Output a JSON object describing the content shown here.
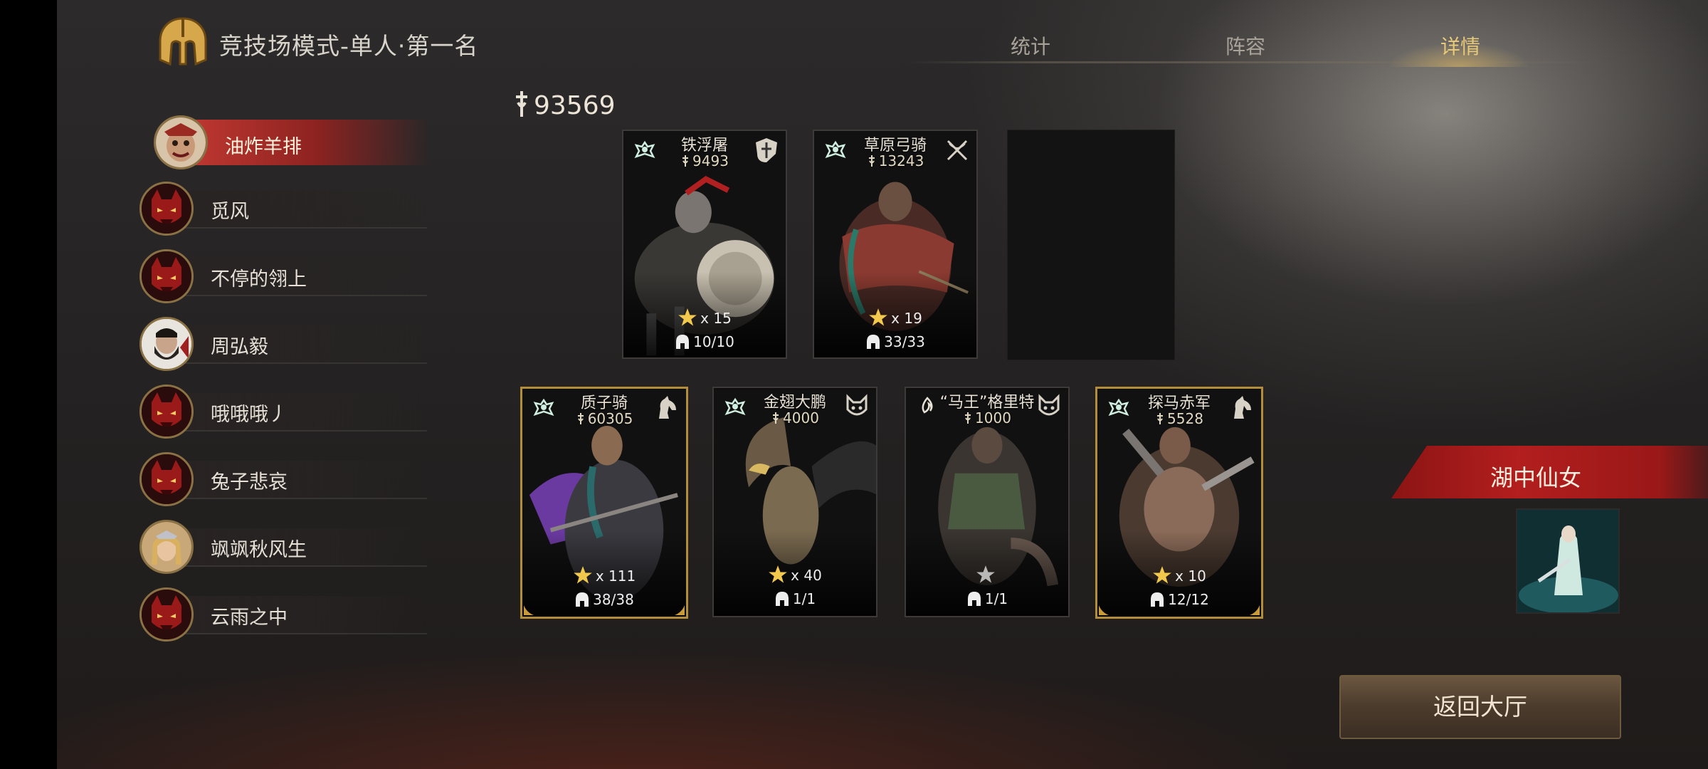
{
  "header": {
    "mode_title": "竞技场模式-单人·第一名",
    "tabs": [
      {
        "label": "统计",
        "active": false
      },
      {
        "label": "阵容",
        "active": false
      },
      {
        "label": "详情",
        "active": true
      }
    ]
  },
  "players": [
    {
      "name": "油炸羊排",
      "avatar": "jester-avatar",
      "selected": true
    },
    {
      "name": "觅风",
      "avatar": "demon-mask-avatar"
    },
    {
      "name": "不停的翎上",
      "avatar": "demon-mask-avatar"
    },
    {
      "name": "周弘毅",
      "avatar": "bearded-warrior-avatar"
    },
    {
      "name": "哦哦哦丿",
      "avatar": "demon-mask-avatar"
    },
    {
      "name": "兔子悲哀",
      "avatar": "demon-mask-avatar"
    },
    {
      "name": "飒飒秋风生",
      "avatar": "female-warrior-avatar"
    },
    {
      "name": "云雨之中",
      "avatar": "demon-mask-avatar"
    }
  ],
  "power_total": "93569",
  "units_row1": [
    {
      "name": "铁浮屠",
      "power": "9493",
      "stars": "x 15",
      "count": "10/10",
      "class_icon": "shield-cross-icon",
      "gold": false
    },
    {
      "name": "草原弓骑",
      "power": "13243",
      "stars": "x 19",
      "count": "33/33",
      "class_icon": "crossed-bow-icon",
      "gold": false
    }
  ],
  "units_row2": [
    {
      "name": "质子骑",
      "power": "60305",
      "stars": "x 111",
      "count": "38/38",
      "class_icon": "horse-head-icon",
      "gold": true
    },
    {
      "name": "金翅大鹏",
      "power": "4000",
      "stars": "x 40",
      "count": "1/1",
      "class_icon": "beast-mask-icon",
      "gold": false
    },
    {
      "name": "“马王”格里特",
      "power": "1000",
      "stars": "",
      "count": "1/1",
      "class_icon": "beast-mask-icon",
      "gold": false
    },
    {
      "name": "探马赤军",
      "power": "5528",
      "stars": "x 10",
      "count": "12/12",
      "class_icon": "horse-head-icon",
      "gold": true
    }
  ],
  "hero": {
    "name": "湖中仙女"
  },
  "return_button": "返回大厅",
  "colors": {
    "accent_gold": "#e8c879",
    "selected_red": "#c53a33",
    "hero_banner": "#b31e1e"
  }
}
